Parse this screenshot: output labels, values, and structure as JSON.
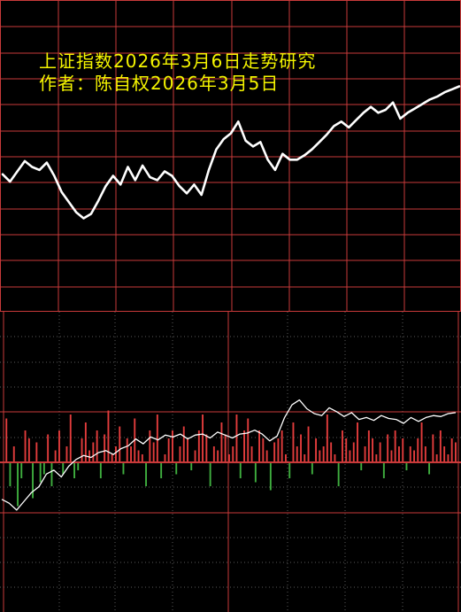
{
  "header": {
    "title_line_1": "上证指数2026年3月6日走势研究",
    "title_line_2": "作者：陈自权2026年3月5日"
  },
  "colors": {
    "background": "#000000",
    "grid": "#c83a3a",
    "title": "#f5f500",
    "line": "#ffffff",
    "bar_up": "#e23c3c",
    "bar_down": "#3fae3f",
    "dotted_grid": "#5a5a5a"
  },
  "chart_data": [
    {
      "type": "line",
      "series": [
        {
          "values": [
            4.0,
            3.5,
            4.2,
            4.9,
            4.5,
            4.3,
            4.8,
            3.9,
            2.8,
            2.1,
            1.4,
            1.0,
            1.3,
            2.2,
            3.2,
            3.9,
            3.3,
            4.5,
            3.6,
            4.6,
            3.8,
            3.6,
            4.2,
            3.9,
            3.2,
            2.7,
            3.3,
            2.6,
            4.3,
            5.7,
            6.4,
            6.8,
            7.6,
            6.3,
            5.9,
            6.2,
            5.0,
            4.3,
            5.4,
            5.0,
            5.0,
            5.3,
            5.7,
            6.2,
            6.7,
            7.3,
            7.6,
            7.2,
            7.7,
            8.2,
            8.6,
            8.2,
            8.4,
            8.9,
            7.8,
            8.2,
            8.5,
            8.8,
            9.1,
            9.3,
            9.6,
            9.8,
            10.0
          ]
        }
      ]
    },
    {
      "type": "line",
      "series": [
        {
          "values": [
            -3.8,
            -4.2,
            -4.9,
            -4.0,
            -3.1,
            -2.5,
            -1.2,
            -0.8,
            -1.5,
            -0.4,
            0.3,
            0.7,
            0.5,
            1.0,
            1.2,
            0.8,
            1.4,
            1.7,
            2.4,
            1.9,
            2.6,
            2.3,
            2.8,
            2.6,
            2.9,
            2.4,
            2.8,
            2.9,
            2.5,
            3.1,
            2.8,
            2.5,
            2.9,
            3.0,
            3.3,
            2.9,
            2.2,
            2.7,
            4.6,
            5.9,
            6.4,
            5.5,
            5.0,
            4.8,
            5.6,
            5.2,
            4.7,
            5.1,
            4.4,
            4.6,
            4.3,
            4.8,
            4.5,
            4.4,
            4.0,
            4.6,
            4.2,
            4.6,
            4.8,
            4.7,
            5.0,
            5.1
          ]
        }
      ]
    },
    {
      "type": "bar",
      "series": [
        {
          "values": [
            5.5,
            -3,
            2,
            -5.5,
            -2,
            4,
            3,
            -4.5,
            2.5,
            -2.5,
            -1.5,
            3.5,
            -3,
            1.5,
            4,
            -1.5,
            2,
            6,
            -2,
            -1,
            3,
            5,
            1.5,
            2.5,
            4,
            -2,
            3.5,
            6.5,
            1,
            2,
            4.5,
            -1.5,
            3,
            2,
            5.5,
            1.5,
            1,
            -3,
            4,
            2.5,
            6,
            -2,
            1,
            3,
            4,
            -1.5,
            2,
            4.5,
            3,
            -1,
            1.5,
            4,
            6,
            3.5,
            -3,
            2,
            1.5,
            5,
            3.5,
            1,
            2,
            6,
            -2,
            4,
            5.5,
            2,
            -2.5,
            4,
            3,
            1.5,
            -3.5,
            2.5,
            3,
            4,
            1,
            -2,
            5,
            2,
            3.5,
            1,
            4.5,
            -1.5,
            3,
            1.5,
            2,
            6,
            2.5,
            1,
            -3,
            4,
            3,
            1.5,
            2.5,
            5,
            -1,
            2,
            4,
            3,
            1,
            2.5,
            -2,
            3.5,
            1.5,
            4,
            2,
            3,
            -1,
            2,
            1.5,
            3,
            5,
            2,
            -1.5,
            3.5,
            1,
            4,
            2,
            1,
            3,
            2.5
          ]
        }
      ]
    }
  ]
}
